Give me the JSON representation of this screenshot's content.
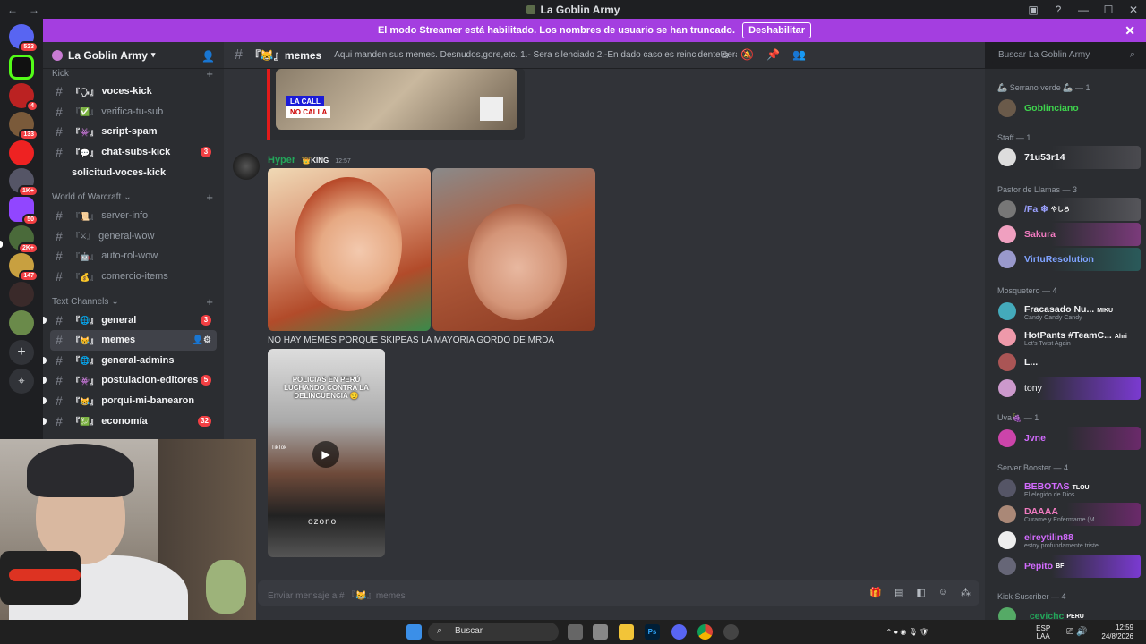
{
  "window": {
    "title": "La Goblin Army",
    "nav_back": "←",
    "nav_forward": "→"
  },
  "banner": {
    "text": "El modo Streamer está habilitado. Los nombres de usuario se han truncado.",
    "button": "Deshabilitar",
    "close": "✕"
  },
  "guilds": [
    {
      "badge": "523"
    },
    {
      "badge": ""
    },
    {
      "badge": "4"
    },
    {
      "badge": "133"
    },
    {
      "badge": ""
    },
    {
      "badge": "1K+"
    },
    {
      "badge": "50"
    },
    {
      "badge": "2K+"
    },
    {
      "badge": "147"
    },
    {
      "badge": ""
    },
    {
      "badge": ""
    }
  ],
  "server": {
    "name": "La Goblin Army"
  },
  "sidebar": {
    "cat_kick": "Kick",
    "kick_channels": [
      {
        "emoji": "『🗣』",
        "name": "voces-kick",
        "unread": true,
        "badge": ""
      },
      {
        "emoji": "『✅』",
        "name": "verifica-tu-sub",
        "unread": false,
        "badge": ""
      },
      {
        "emoji": "『👾』",
        "name": "script-spam",
        "unread": true,
        "badge": ""
      },
      {
        "emoji": "『💬』",
        "name": "chat-subs-kick",
        "unread": true,
        "badge": "3"
      },
      {
        "emoji": "",
        "name": "solicitud-voces-kick",
        "unread": true,
        "badge": ""
      }
    ],
    "cat_wow": "World of Warcraft",
    "wow_channels": [
      {
        "emoji": "『📜』",
        "name": "server-info",
        "unread": false,
        "badge": ""
      },
      {
        "emoji": "『⚔』",
        "name": "general-wow",
        "unread": false,
        "badge": ""
      },
      {
        "emoji": "『🤖』",
        "name": "auto-rol-wow",
        "unread": false,
        "badge": ""
      },
      {
        "emoji": "『💰』",
        "name": "comercio-items",
        "unread": false,
        "badge": ""
      }
    ],
    "cat_text": "Text Channels",
    "text_channels": [
      {
        "emoji": "『🌐』",
        "name": "general",
        "unread": true,
        "badge": "3"
      },
      {
        "emoji": "『😹』",
        "name": "memes",
        "active": true,
        "badge": ""
      },
      {
        "emoji": "『🌐』",
        "name": "general-admins",
        "unread": true,
        "badge": ""
      },
      {
        "emoji": "『👾』",
        "name": "postulacion-editores",
        "unread": true,
        "badge": "5"
      },
      {
        "emoji": "『😹』",
        "name": "porqui-mi-banearon",
        "unread": true,
        "badge": ""
      },
      {
        "emoji": "『💹』",
        "name": "economía",
        "unread": true,
        "badge": "32"
      }
    ]
  },
  "channel": {
    "name": "『😹』memes",
    "topic": "Aqui manden sus memes. Desnudos,gore,etc. 1.- Sera silenciado 2.-En dado caso es reincidente sera baneado"
  },
  "search_placeholder": "Buscar La Goblin Army",
  "message": {
    "author": "Hyper",
    "role": "👑KING",
    "time": "12:57",
    "caption": "NO HAY MEMES PORQUE SKIPEAS LA MAYORIA GORDO DE MRDA",
    "prev_embed_text1": "LA CALL",
    "prev_embed_text2": "NO CALLA",
    "video_title": "POLICIAS EN PERÚ LUCHANDO CONTRA LA DELINCUENCIA 😏",
    "video_brand": "ozono",
    "video_tiktok": "TikTok"
  },
  "composer": {
    "placeholder": "Enviar mensaje a # 『😹』memes"
  },
  "members": {
    "groups": [
      {
        "title": "🦾 Serrano verde 🦾 — 1"
      },
      {
        "title": "Staff — 1"
      },
      {
        "title": "Pastor de Llamas — 3"
      },
      {
        "title": "Mosquetero — 4"
      },
      {
        "title": "Uva🍇 — 1"
      },
      {
        "title": "Server Booster — 4"
      },
      {
        "title": "Kick Suscriber — 4"
      }
    ],
    "list": [
      {
        "name": "Goblinciano",
        "status": "",
        "tag": "",
        "color": "#3ed44d"
      },
      {
        "name": "71u53r14",
        "status": "",
        "tag": "",
        "color": "#f2f3f5"
      },
      {
        "name": "/Fa ❄",
        "status": "",
        "tag": "やしろ",
        "color": "#9ba1ff"
      },
      {
        "name": "Sakura",
        "status": "",
        "tag": "",
        "color": "#f27bc1"
      },
      {
        "name": "VirtuResolution",
        "status": "",
        "tag": "",
        "color": "#7fa2ff"
      },
      {
        "name": "Fracasado Nu...",
        "status": "Candy Candy Candy",
        "tag": "MIKU",
        "color": "#f2f3f5"
      },
      {
        "name": "HotPants #TeamC...",
        "status": "Let's Twist Again",
        "tag": "Ahri",
        "color": "#f2f3f5"
      },
      {
        "name": "L...",
        "status": "",
        "tag": "",
        "color": "#f2f3f5"
      },
      {
        "name": "tony",
        "status": "",
        "tag": "",
        "color": "#f2f3f5"
      },
      {
        "name": "Jvne",
        "status": "",
        "tag": "",
        "color": "#d36bff"
      },
      {
        "name": "BEBOTAS",
        "status": "El elegido de Dios",
        "tag": "TLOU",
        "color": "#d36bff"
      },
      {
        "name": "DAAAA",
        "status": "Curame y Enfermame (M...",
        "tag": "",
        "color": "#f27bc1"
      },
      {
        "name": "elreytilin88",
        "status": "estoy profundamente triste",
        "tag": "",
        "color": "#d36bff"
      },
      {
        "name": "Pepito",
        "status": "",
        "tag": "BF",
        "color": "#d36bff"
      },
      {
        "name": "_cevichc",
        "status": "",
        "tag": "PERU",
        "color": "#23a55a"
      }
    ]
  },
  "taskbar": {
    "search": "Buscar",
    "lang1": "ESP",
    "lang2": "LAA",
    "time": "12:59",
    "date": "24/8/2026"
  },
  "colors": {
    "accent": "#a43ee0",
    "online": "#23a55a",
    "badge": "#f23f43"
  }
}
